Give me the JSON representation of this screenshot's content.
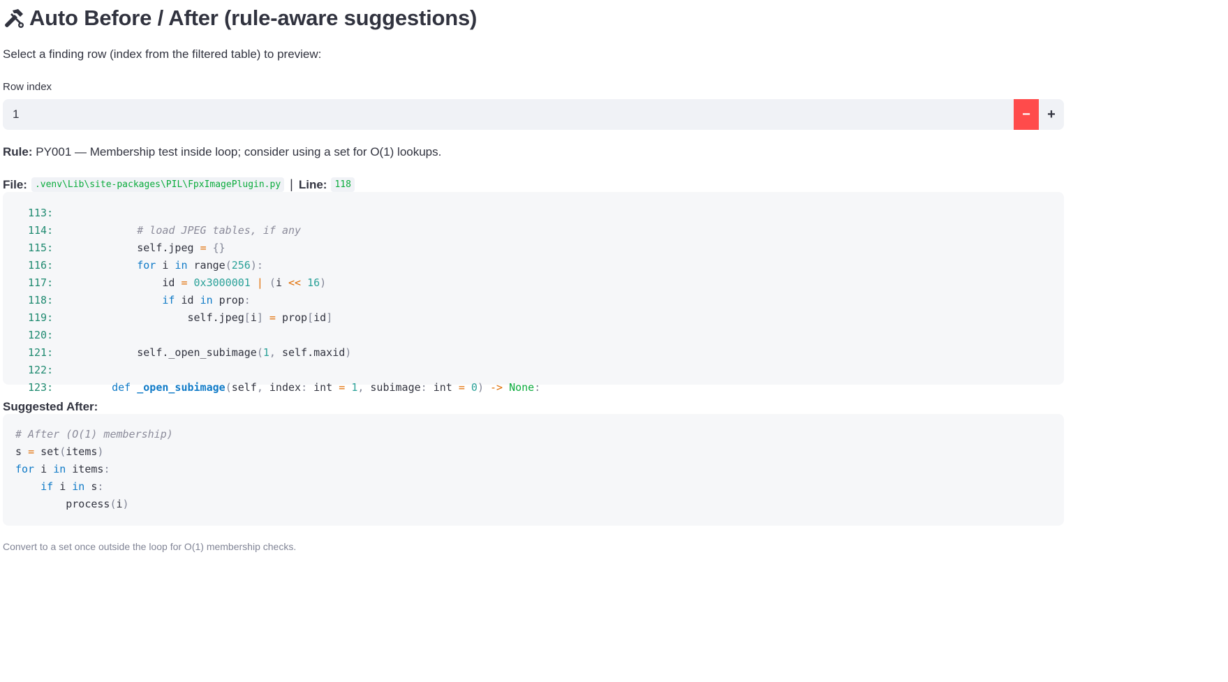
{
  "header": {
    "title": "Auto Before / After (rule-aware suggestions)",
    "icon": "hammer-wrench-icon"
  },
  "intro": "Select a finding row (index from the filtered table) to preview:",
  "row_index": {
    "label": "Row index",
    "value": "1",
    "minus_label": "−",
    "plus_label": "+"
  },
  "rule": {
    "label": "Rule:",
    "text": "PY001 — Membership test inside loop; consider using a set for O(1) lookups."
  },
  "file": {
    "label": "File:",
    "path": ".venv\\Lib\\site-packages\\PIL\\FpxImagePlugin.py",
    "separator": "|",
    "line_label": "Line:",
    "line_value": "118"
  },
  "before_code": {
    "line_numbers": [
      "113:",
      "114:",
      "115:",
      "116:",
      "117:",
      "118:",
      "119:",
      "120:",
      "121:",
      "122:",
      "123:"
    ]
  },
  "after": {
    "title": "Suggested After:",
    "caption": "Convert to a set once outside the loop for O(1) membership checks."
  },
  "colors": {
    "accent": "#ff4b4b",
    "code_green": "#09ab3b",
    "keyword_blue": "#0f7ac7"
  }
}
